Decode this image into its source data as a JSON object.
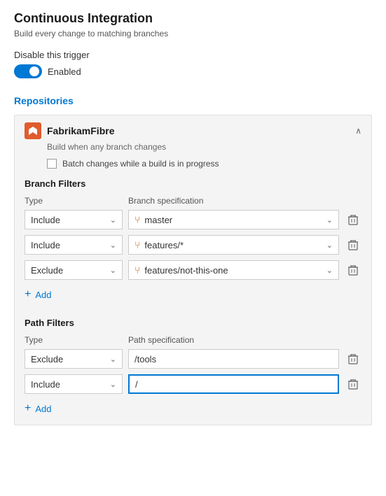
{
  "page": {
    "title": "Continuous Integration",
    "subtitle": "Build every change to matching branches"
  },
  "trigger": {
    "disable_label": "Disable this trigger",
    "toggle_state": "enabled",
    "toggle_text": "Enabled"
  },
  "repositories_section": {
    "title": "Repositories",
    "repo": {
      "name": "FabrikamFibre",
      "subtitle": "Build when any branch changes",
      "batch_label": "Batch changes while a build is in progress"
    }
  },
  "branch_filters": {
    "title": "Branch Filters",
    "type_header": "Type",
    "spec_header": "Branch specification",
    "rows": [
      {
        "type": "Include",
        "spec": "master"
      },
      {
        "type": "Include",
        "spec": "features/*"
      },
      {
        "type": "Exclude",
        "spec": "features/not-this-one"
      }
    ],
    "add_label": "Add"
  },
  "path_filters": {
    "title": "Path Filters",
    "type_header": "Type",
    "spec_header": "Path specification",
    "rows": [
      {
        "type": "Exclude",
        "spec": "/tools",
        "active": false
      },
      {
        "type": "Include",
        "spec": "/",
        "active": true
      }
    ],
    "add_label": "Add"
  },
  "icons": {
    "chevron_up": "∧",
    "chevron_down": "⌄",
    "plus": "+",
    "branch": "⑂",
    "delete": "🗑"
  }
}
